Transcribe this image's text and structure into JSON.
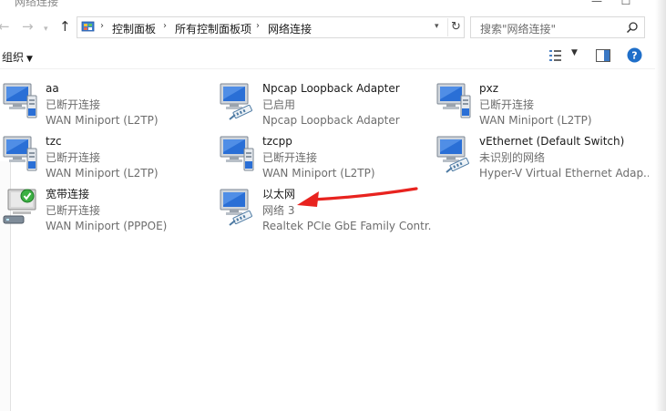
{
  "window": {
    "title": "网络连接",
    "minimize_icon": "minimize-icon",
    "maximize_icon": "maximize-icon"
  },
  "address_bar": {
    "breadcrumbs": [
      "控制面板",
      "所有控制面板项",
      "网络连接"
    ],
    "search_placeholder": "搜索\"网络连接\""
  },
  "toolbar": {
    "organize_label": "组织"
  },
  "connections": [
    {
      "name": "aa",
      "status": "已断开连接",
      "device": "WAN Miniport (L2TP)",
      "icon": "vpn-monitor-icon"
    },
    {
      "name": "Npcap Loopback Adapter",
      "status": "已启用",
      "device": "Npcap Loopback Adapter",
      "icon": "ethernet-monitor-icon"
    },
    {
      "name": "pxz",
      "status": "已断开连接",
      "device": "WAN Miniport (L2TP)",
      "icon": "vpn-monitor-icon"
    },
    {
      "name": "tzc",
      "status": "已断开连接",
      "device": "WAN Miniport (L2TP)",
      "icon": "vpn-monitor-icon"
    },
    {
      "name": "tzcpp",
      "status": "已断开连接",
      "device": "WAN Miniport (L2TP)",
      "icon": "vpn-monitor-icon"
    },
    {
      "name": "vEthernet (Default Switch)",
      "status": "未识别的网络",
      "device": "Hyper-V Virtual Ethernet Adap...",
      "icon": "ethernet-monitor-icon"
    },
    {
      "name": "宽带连接",
      "status": "已断开连接",
      "device": "WAN Miniport (PPPOE)",
      "icon": "broadband-modem-icon"
    },
    {
      "name": "以太网",
      "status": "网络 3",
      "device": "Realtek PCIe GbE Family Contr...",
      "icon": "ethernet-monitor-icon"
    }
  ],
  "colors": {
    "annotation_arrow": "#e8231f",
    "monitor_blue": "#2a6fd6",
    "status_gray": "#6d6d6d"
  }
}
